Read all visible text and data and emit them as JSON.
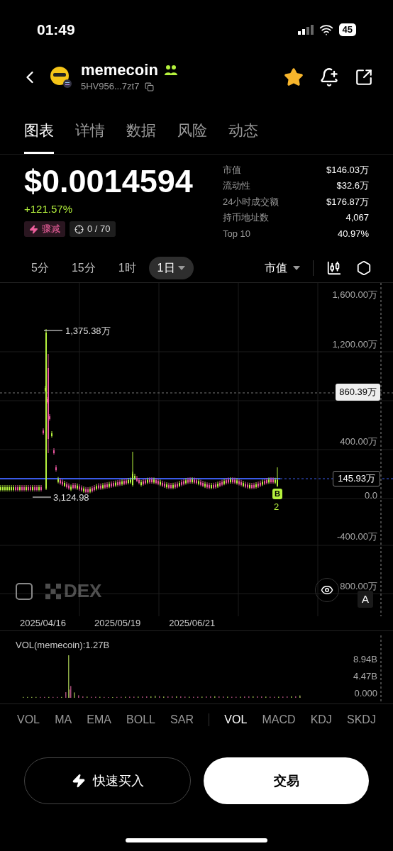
{
  "status_bar": {
    "time": "01:49",
    "battery": "45"
  },
  "token": {
    "name": "memecoin",
    "address": "5HV956...7zt7",
    "favorite": true
  },
  "tabs": [
    {
      "label": "图表",
      "selected": true
    },
    {
      "label": "详情",
      "selected": false
    },
    {
      "label": "数据",
      "selected": false
    },
    {
      "label": "风险",
      "selected": false
    },
    {
      "label": "动态",
      "selected": false
    }
  ],
  "price": {
    "value": "$0.0014594",
    "change": "+121.57%",
    "tags": [
      {
        "kind": "alert",
        "label": "骤减"
      },
      {
        "kind": "target",
        "label": "0 / 70"
      }
    ]
  },
  "stats": [
    {
      "label": "市值",
      "value": "$146.03万"
    },
    {
      "label": "流动性",
      "value": "$32.6万"
    },
    {
      "label": "24小时成交额",
      "value": "$176.87万"
    },
    {
      "label": "持币地址数",
      "value": "4,067"
    },
    {
      "label": "Top 10",
      "value": "40.97%"
    }
  ],
  "intervals": [
    {
      "label": "5分",
      "selected": false
    },
    {
      "label": "15分",
      "selected": false
    },
    {
      "label": "1时",
      "selected": false
    },
    {
      "label": "1日",
      "selected": true
    }
  ],
  "metric_dropdown": "市值",
  "chart": {
    "y_labels": [
      "1,600.00万",
      "1,200.00万",
      "400.00万",
      "0.0",
      "-400.00万",
      "800.00万"
    ],
    "crosshair_value": "860.39万",
    "current_value": "145.93万",
    "high_label": "1,375.38万",
    "low_label": "3,124.98",
    "marker": {
      "letter": "B",
      "count": "2"
    },
    "watermark": "DEX",
    "auto_label": "A",
    "dates": [
      "2025/04/16",
      "2025/05/19",
      "2025/06/21"
    ]
  },
  "volume": {
    "title": "VOL(memecoin):1.27B",
    "y_labels": [
      "8.94B",
      "4.47B",
      "0.000"
    ]
  },
  "main_indicators": [
    {
      "label": "VOL",
      "selected": false
    },
    {
      "label": "MA",
      "selected": false
    },
    {
      "label": "EMA",
      "selected": false
    },
    {
      "label": "BOLL",
      "selected": false
    },
    {
      "label": "SAR",
      "selected": false
    }
  ],
  "sub_indicators": [
    {
      "label": "VOL",
      "selected": true
    },
    {
      "label": "MACD",
      "selected": false
    },
    {
      "label": "KDJ",
      "selected": false
    },
    {
      "label": "SKDJ",
      "selected": false
    }
  ],
  "buttons": {
    "quick_buy": "快速买入",
    "trade": "交易"
  }
}
